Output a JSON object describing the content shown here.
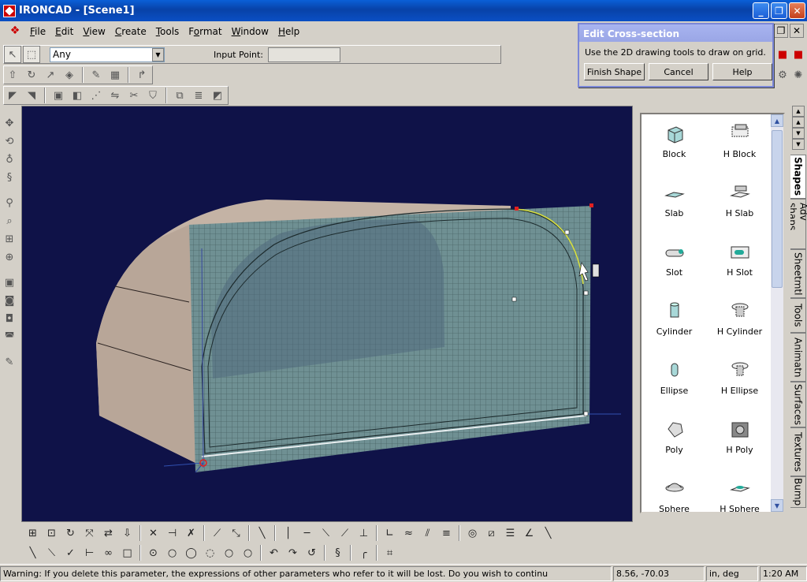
{
  "window": {
    "title": "IRONCAD - [Scene1]",
    "minimize": "_",
    "restore": "❐",
    "close": "✕"
  },
  "menu": {
    "items": [
      {
        "label": "File",
        "key": "F"
      },
      {
        "label": "Edit",
        "key": "E"
      },
      {
        "label": "View",
        "key": "V"
      },
      {
        "label": "Create",
        "key": "C"
      },
      {
        "label": "Tools",
        "key": "T"
      },
      {
        "label": "Format",
        "key": "o"
      },
      {
        "label": "Window",
        "key": "W"
      },
      {
        "label": "Help",
        "key": "H"
      }
    ]
  },
  "toolbar": {
    "filter_value": "Any",
    "input_point_label": "Input Point:",
    "input_point_value": ""
  },
  "dialog": {
    "title": "Edit Cross-section",
    "message": "Use the 2D drawing tools to draw on grid.",
    "finish_label": "Finish Shape",
    "cancel_label": "Cancel",
    "help_label": "Help"
  },
  "catalog": {
    "shapes": [
      {
        "label": "Block",
        "icon": "block-icon"
      },
      {
        "label": "H Block",
        "icon": "h-block-icon"
      },
      {
        "label": "Slab",
        "icon": "slab-icon"
      },
      {
        "label": "H Slab",
        "icon": "h-slab-icon"
      },
      {
        "label": "Slot",
        "icon": "slot-icon"
      },
      {
        "label": "H Slot",
        "icon": "h-slot-icon"
      },
      {
        "label": "Cylinder",
        "icon": "cylinder-icon"
      },
      {
        "label": "H Cylinder",
        "icon": "h-cylinder-icon"
      },
      {
        "label": "Ellipse",
        "icon": "ellipse-icon"
      },
      {
        "label": "H Ellipse",
        "icon": "h-ellipse-icon"
      },
      {
        "label": "Poly",
        "icon": "poly-icon"
      },
      {
        "label": "H Poly",
        "icon": "h-poly-icon"
      },
      {
        "label": "Sphere",
        "icon": "sphere-icon"
      },
      {
        "label": "H Sphere",
        "icon": "h-sphere-icon"
      }
    ],
    "tabs": [
      "Shapes",
      "Adv shaps",
      "Sheetmtl",
      "Tools",
      "Animatn",
      "Surfaces",
      "Textures",
      "Bump"
    ]
  },
  "status": {
    "message": "Warning: If you delete this parameter, the expressions of other parameters who refer to it will be lost. Do you wish to continu",
    "coords": "8.56, -70.03",
    "units": "in, deg",
    "time": "1:20 AM"
  },
  "colors": {
    "viewport_bg": "#0f1248",
    "shell": "#c5b4a6",
    "grid": "#6a8a8c",
    "title_blue": "#0a4fc4"
  }
}
